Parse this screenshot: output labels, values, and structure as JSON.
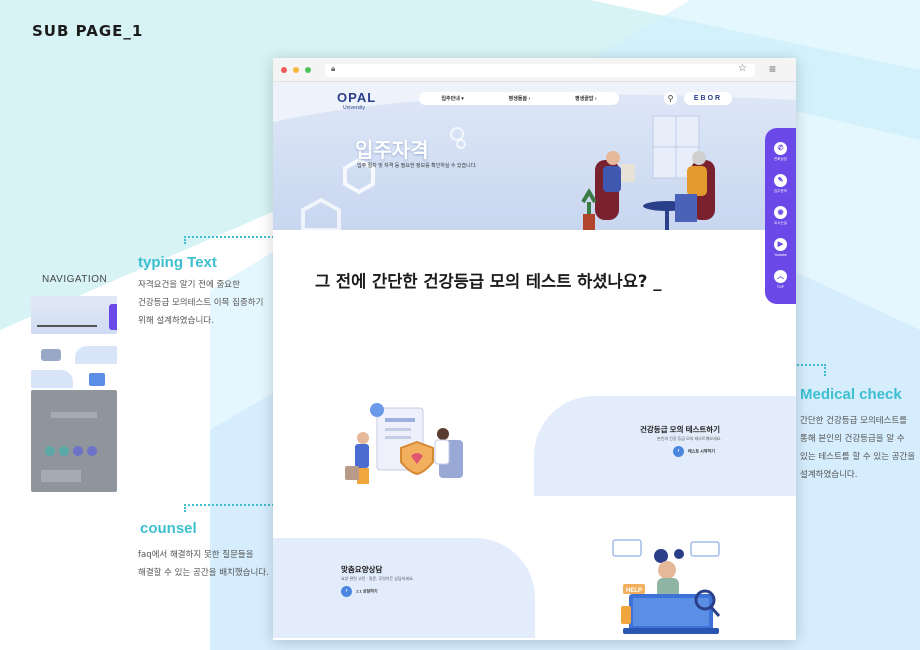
{
  "page_label": "SUB PAGE_1",
  "navigation_label": "NAVIGATION",
  "annotations": {
    "typing": {
      "title": "typing Text",
      "desc": [
        "자격요건을 알기 전에 중요한",
        "건강등급 모의테스트 이목 집중하기",
        "위해 설계하였습니다."
      ]
    },
    "medical": {
      "title": "Medical check",
      "desc": [
        "간단한 건강등급 모의테스트를",
        "통해 본인의 건강등급을 알 수",
        "있는 테스트를 할 수 있는 공간을",
        "설계하였습니다."
      ]
    },
    "counsel": {
      "title": "counsel",
      "desc": [
        "faq에서 해결하지 못한 질문들을",
        "해결할 수 있는 공간을 배치했습니다."
      ]
    }
  },
  "browser": {
    "logo": "OPAL",
    "logo_sub": "University",
    "nav": [
      "입주안내 ▾",
      "평생돌봄 ›",
      "평생끝맙 ›"
    ],
    "brand": "EBOR",
    "hero_title": "입주자격",
    "hero_sub": "입주 절차 및 자격 등 필요한 정보를 확인하실 수 있습니다.",
    "typing_headline": "그 전에 간단한 건강등급 모의 테스트 하셨나요? _",
    "side_menu": [
      "전화상담",
      "입주문의",
      "오시는길",
      "Youtube",
      "TOP"
    ],
    "medical_card": {
      "title": "건강등급 모의 테스트하기",
      "sub": "본인의 건강 등급 모의 테스트해보세요.",
      "button": "테스트 시작하기"
    },
    "counsel_card": {
      "title": "맞춤요양상담",
      "sub": "요양 관련 고민 · 질문, 무엇이든 상담하세요.",
      "button": "1:1 상담하기"
    },
    "help_tag": "HELP"
  },
  "colors": {
    "accent": "#3dbfd0",
    "purple": "#6b48e8",
    "card": "#e3ecfb"
  }
}
